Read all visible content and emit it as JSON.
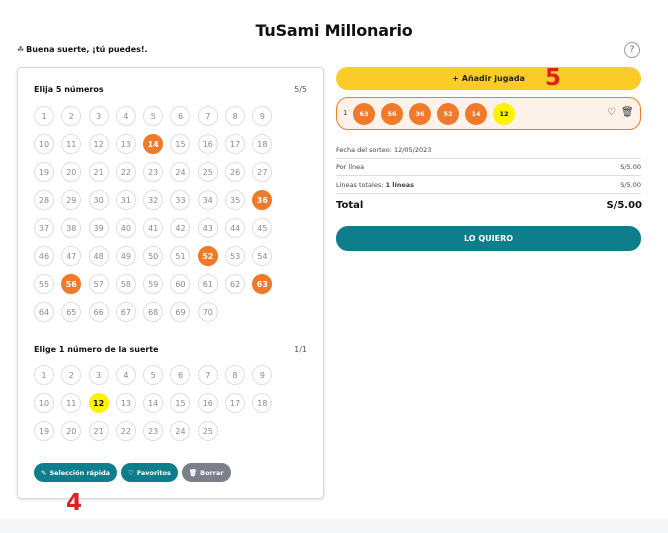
{
  "header": {
    "title": "TuSami Millonario",
    "tagline": "Buena suerte, ¡tú puedes!.",
    "help_symbol": "?"
  },
  "main_numbers": {
    "title": "Elija 5 números",
    "count": "5/5",
    "max": 70,
    "selected": [
      14,
      36,
      52,
      56,
      63
    ]
  },
  "luck_numbers": {
    "title": "Elige 1 número de la suerte",
    "count": "1/1",
    "max": 25,
    "selected": [
      12
    ]
  },
  "actions": {
    "quick_pick": "Selección rápida",
    "favorites": "Favoritos",
    "clear": "Borrar"
  },
  "add_play": {
    "label": "Añadir jugada"
  },
  "annotations": {
    "marker_4": "4",
    "marker_5": "5"
  },
  "ticket_line": {
    "index": "1",
    "main": [
      "63",
      "56",
      "36",
      "52",
      "14"
    ],
    "luck": "12"
  },
  "summary": {
    "draw_date": "Fecha del sorteo: 12/05/2023",
    "per_line_label": "Por línea",
    "per_line_value": "S/5.00",
    "total_lines_label": "Líneas totales:",
    "total_lines_value": "1 líneas",
    "total_lines_amount": "S/5.00",
    "total_label": "Total",
    "total_value": "S/5.00"
  },
  "buy": {
    "label": "LO QUIERO"
  },
  "colors": {
    "selected_main": "#ee7a2a",
    "selected_luck": "#fdf200",
    "primary_teal": "#0e7d8c",
    "add_yellow": "#fbcb27",
    "annotation_red": "#e02020"
  }
}
